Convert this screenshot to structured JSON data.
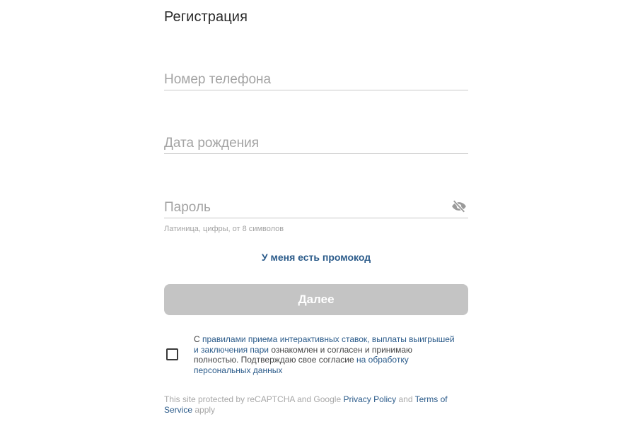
{
  "header": {
    "title": "Регистрация"
  },
  "form": {
    "phone": {
      "placeholder": "Номер телефона",
      "value": ""
    },
    "birth_date": {
      "placeholder": "Дата рождения",
      "value": ""
    },
    "password": {
      "placeholder": "Пароль",
      "value": "",
      "hint": "Латиница, цифры, от 8 символов",
      "toggle_icon": "eye-off-icon"
    },
    "promo_link": "У меня есть промокод",
    "next_button": "Далее"
  },
  "agreement": {
    "checked": false,
    "text_1": "С ",
    "link_rules": "правилами приема интерактивных ставок, выплаты выигрышей и заключения пари",
    "text_2": " ознакомлен и согласен и принимаю полностью. Подтверждаю свое согласие ",
    "link_personal": "на обработку персональных данных"
  },
  "legal": {
    "text_1": "This site protected by reCAPTCHA and Google ",
    "privacy_link": "Privacy Policy",
    "text_2": " and ",
    "terms_link": "Terms of Service",
    "text_3": " apply"
  },
  "colors": {
    "link": "#2b5b8a",
    "button_disabled": "#c4c4c4",
    "placeholder": "#a3a3a3"
  }
}
